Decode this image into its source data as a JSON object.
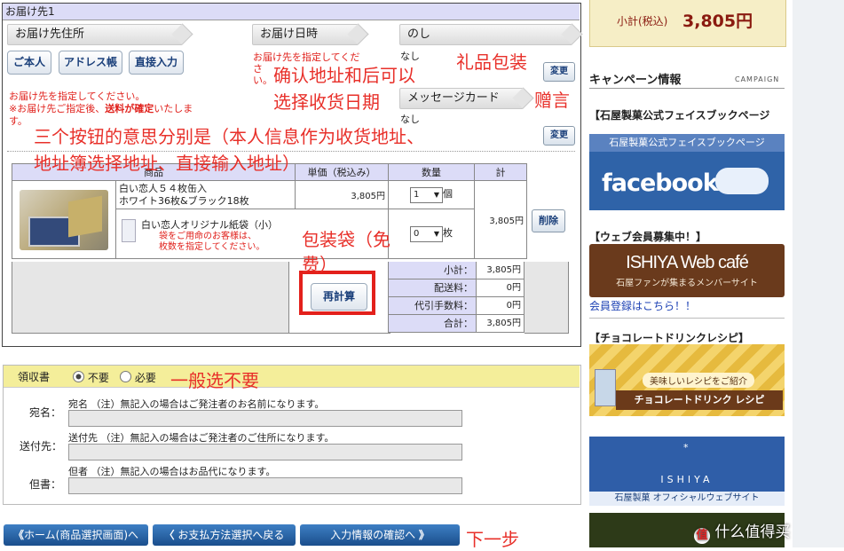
{
  "header": {
    "title": "お届け先1"
  },
  "steps": {
    "address": "お届け先住所",
    "datetime": "お届け日時",
    "noshi": "のし"
  },
  "address_buttons": {
    "self": "ご本人",
    "book": "アドレス帳",
    "direct": "直接入力"
  },
  "address_note": {
    "line1": "お届け先を指定してください。",
    "line2a": "※お届け先ご指定後、",
    "line2b": "送料が確定",
    "line2c": "いたしま",
    "line3": "す。"
  },
  "datetime_note": "お届け先を指定してくださ\nい。",
  "noshi": {
    "value": "なし",
    "change": "変更",
    "message_card_label": "メッセージカード",
    "message_value": "なし",
    "message_change": "変更"
  },
  "table": {
    "headers": [
      "商品",
      "単価（税込み）",
      "数量",
      "計"
    ],
    "item1": {
      "name": "白い恋人５４枚缶入\nホワイト36枚&ブラック18枚",
      "price": "3,805円",
      "qty": "1",
      "qty_unit": "個",
      "total": "3,805円",
      "delete": "削除"
    },
    "item2": {
      "name": "白い恋人オリジナル紙袋（小）",
      "note": "袋をご用命のお客様は、\n枚数を指定してください。",
      "qty": "0",
      "qty_unit": "枚"
    },
    "recalc": "再計算",
    "summary": [
      {
        "label": "小計：",
        "value": "3,805円"
      },
      {
        "label": "配送料：",
        "value": "0円"
      },
      {
        "label": "代引手数料：",
        "value": "0円"
      },
      {
        "label": "合計：",
        "value": "3,805円"
      }
    ]
  },
  "receipt": {
    "title": "領収書",
    "opt_no": "不要",
    "opt_yes": "必要",
    "name_label": "宛名：",
    "name_note": "宛名 （注）無記入の場合はご発注者のお名前になります。",
    "sender_label": "送付先：",
    "sender_note": "送付先 （注）無記入の場合はご発注者のご住所になります。",
    "memo_label": "但書：",
    "memo_note": "但者 （注）無記入の場合はお品代になります。"
  },
  "nav": {
    "home": "ホーム(商品選択画面)へ",
    "back": "お支払方法選択へ戻る",
    "next": "入力情報の確認へ"
  },
  "sidebar": {
    "subtotal_label": "小計(税込)",
    "subtotal_value": "3,805円",
    "campaign_title": "キャンペーン情報",
    "campaign_en": "CAMPAIGN",
    "fb_heading": "【石屋製菓公式フェイスブックページ",
    "fb_banner_title": "石屋製菓公式フェイスブックページ",
    "fb_word": "facebook",
    "member_heading": "【ウェブ会員募集中！】",
    "member_logo": "ISHIYA Web café",
    "member_sub": "石屋ファンが集まるメンバーサイト",
    "member_link": "会員登録はこちら！！",
    "choco_heading": "【チョコレートドリンクレシピ】",
    "choco_tag": "美味しいレシピをご紹介",
    "choco_title": "チョコレートドリンク レシピ",
    "ishiya_logo": "ISHIYA",
    "ishiya_caption": "石屋製菓 オフィシャルウェブサイト",
    "watermark": "什么值得买"
  },
  "annotations": {
    "a1": "确认地址和后可以\n选择收货日期",
    "a2": "礼品包装",
    "a3": "赠言",
    "a4": "三个按钮的意思分别是（本人信息作为收货地址、\n地址簿选择地址、直接输入地址）",
    "a5": "包装袋（免\n费）",
    "a6": "一般选不要",
    "a7": "下一步"
  },
  "colors": {
    "accent_red": "#e0201b",
    "nav_blue": "#1f5597",
    "sidebar_gold": "#f2e8b8",
    "fb_blue": "#2f63a8"
  }
}
